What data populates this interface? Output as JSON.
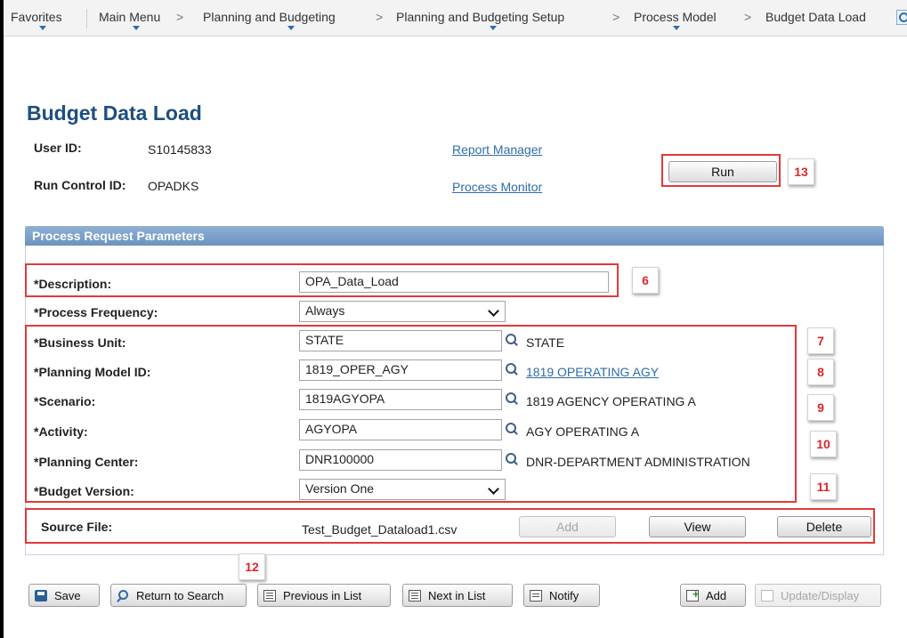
{
  "breadcrumb": {
    "items": [
      "Favorites",
      "Main Menu",
      "Planning and Budgeting",
      "Planning and Budgeting Setup",
      "Process Model",
      "Budget Data Load"
    ],
    "separator": ">"
  },
  "page": {
    "title": "Budget Data Load",
    "user_id_label": "User ID:",
    "user_id_value": "S10145833",
    "run_control_label": "Run Control ID:",
    "run_control_value": "OPADKS",
    "report_manager_link": "Report Manager",
    "process_monitor_link": "Process Monitor",
    "run_button": "Run"
  },
  "panel": {
    "title": "Process Request Parameters",
    "fields": [
      {
        "label": "*Description:",
        "value": "OPA_Data_Load"
      },
      {
        "label": "*Process Frequency:",
        "value": "Always"
      },
      {
        "label": "*Business Unit:",
        "value": "STATE",
        "desc": "STATE"
      },
      {
        "label": "*Planning Model ID:",
        "value": "1819_OPER_AGY",
        "desc": "1819 OPERATING AGY"
      },
      {
        "label": "*Scenario:",
        "value": "1819AGYOPA",
        "desc": "1819 AGENCY OPERATING A"
      },
      {
        "label": "*Activity:",
        "value": "AGYOPA",
        "desc": "AGY OPERATING A"
      },
      {
        "label": "*Planning Center:",
        "value": "DNR100000",
        "desc": "DNR-DEPARTMENT ADMINISTRATION"
      },
      {
        "label": "*Budget Version:",
        "value": "Version One"
      }
    ],
    "source_file": {
      "label": "Source File:",
      "value": "Test_Budget_Dataload1.csv",
      "add_button": "Add",
      "view_button": "View",
      "delete_button": "Delete"
    }
  },
  "callouts": [
    "6",
    "7",
    "8",
    "9",
    "10",
    "11",
    "12",
    "13"
  ],
  "toolbar": {
    "save": "Save",
    "return_to_search": "Return to Search",
    "previous_in_list": "Previous in List",
    "next_in_list": "Next in List",
    "notify": "Notify",
    "add": "Add",
    "update_display": "Update/Display"
  },
  "colors": {
    "title": "#1e4e7f",
    "link": "#2e6ca7",
    "highlight_box": "#e03a3a",
    "callout_text": "#d9272c",
    "panel_header": "#7fa2cb"
  }
}
